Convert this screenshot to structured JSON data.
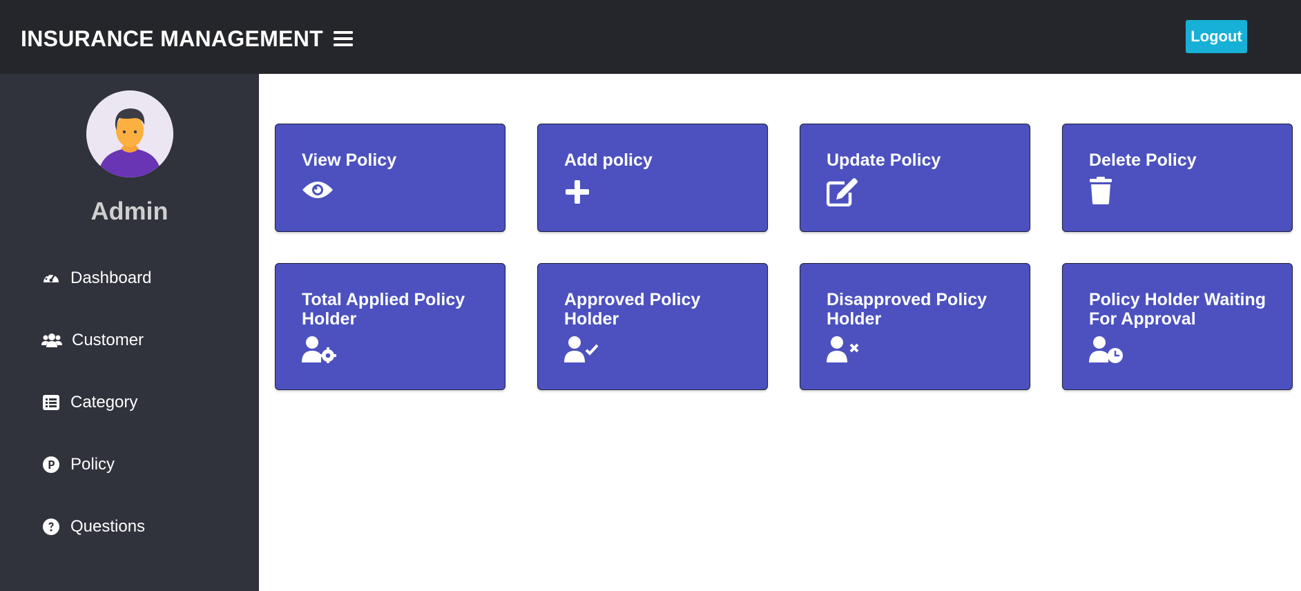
{
  "header": {
    "title": "INSURANCE MANAGEMENT",
    "menu_icon": "hamburger-icon",
    "logout_label": "Logout"
  },
  "sidebar": {
    "role": "Admin",
    "items": [
      {
        "label": "Dashboard",
        "icon": "tachometer-icon"
      },
      {
        "label": "Customer",
        "icon": "users-icon"
      },
      {
        "label": "Category",
        "icon": "list-icon"
      },
      {
        "label": "Policy",
        "icon": "policy-p-icon"
      },
      {
        "label": "Questions",
        "icon": "question-circle-icon"
      }
    ]
  },
  "cards": [
    {
      "title": "View Policy",
      "icon": "eye-icon"
    },
    {
      "title": "Add policy",
      "icon": "plus-icon"
    },
    {
      "title": "Update Policy",
      "icon": "edit-icon"
    },
    {
      "title": "Delete Policy",
      "icon": "trash-icon"
    },
    {
      "title": "Total Applied Policy Holder",
      "icon": "user-gear-icon"
    },
    {
      "title": "Approved Policy Holder",
      "icon": "user-check-icon"
    },
    {
      "title": "Disapproved Policy Holder",
      "icon": "user-x-icon"
    },
    {
      "title": "Policy Holder Waiting For Approval",
      "icon": "user-clock-icon"
    }
  ],
  "colors": {
    "topbar": "#25262b",
    "sidebar": "#30323c",
    "card": "#4c51bf",
    "logout": "#17b0d6"
  }
}
